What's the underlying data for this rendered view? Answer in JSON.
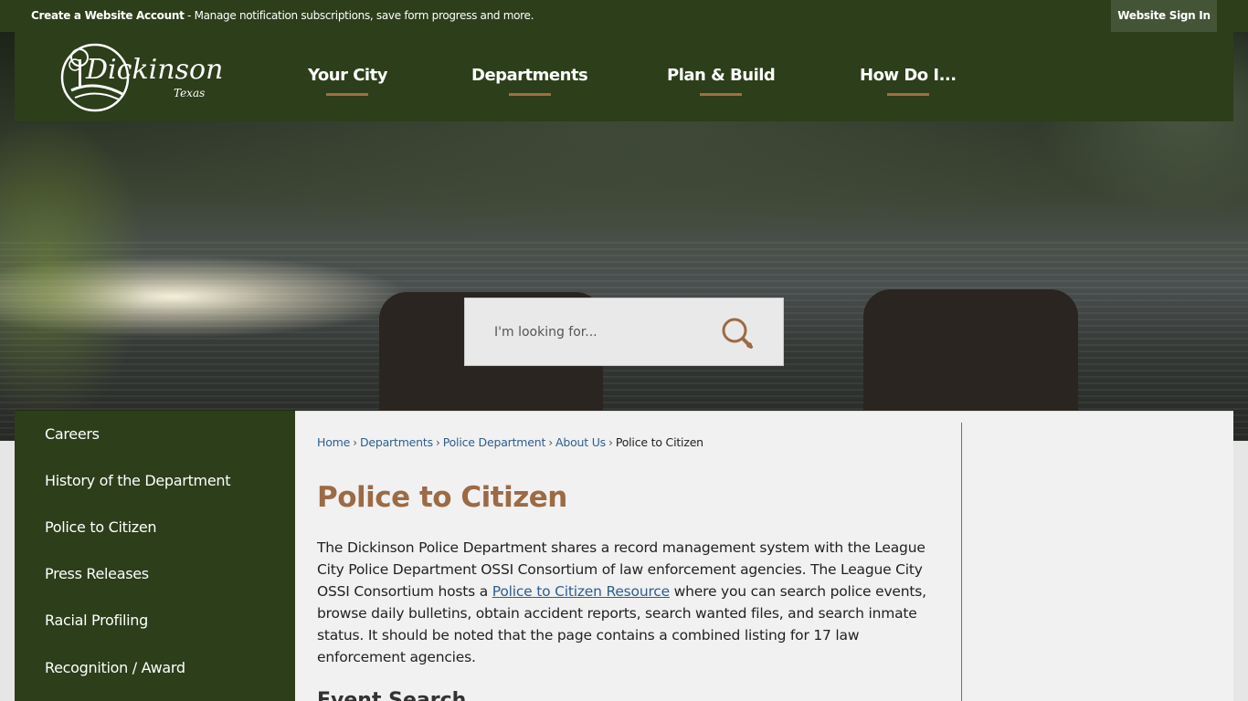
{
  "topbar": {
    "account_title": "Create a Website Account",
    "account_desc": " - Manage notification subscriptions, save form progress and more.",
    "signin_label": "Website Sign In"
  },
  "header": {
    "logo_text": "Dickinson",
    "logo_sub": "Texas",
    "nav": [
      {
        "label": "Your City"
      },
      {
        "label": "Departments"
      },
      {
        "label": "Plan & Build"
      },
      {
        "label": "How Do I..."
      }
    ]
  },
  "search": {
    "placeholder": "I'm looking for..."
  },
  "sidebar": {
    "items": [
      {
        "label": "Careers"
      },
      {
        "label": "History of the Department"
      },
      {
        "label": "Police to Citizen"
      },
      {
        "label": "Press Releases"
      },
      {
        "label": "Racial Profiling"
      },
      {
        "label": "Recognition / Award"
      }
    ]
  },
  "breadcrumb": {
    "items": [
      "Home",
      "Departments",
      "Police Department",
      "About Us"
    ],
    "current": "Police to Citizen"
  },
  "main": {
    "title": "Police to Citizen",
    "para_part1": "The Dickinson Police Department shares a record management system with the League City Police Department OSSI Consortium of law enforcement agencies. The League City OSSI Consortium hosts a ",
    "para_link": "Police to Citizen Resource",
    "para_part2": " where you can search police events, browse daily bulletins, obtain accident reports, search wanted files, and search inmate status. It should be noted that the page contains a combined listing for 17 law enforcement agencies.",
    "subhead": "Event Search"
  },
  "colors": {
    "brand_green": "#2c3e1a",
    "accent_brown": "#9c6a45",
    "link_blue": "#2d5e8e"
  }
}
